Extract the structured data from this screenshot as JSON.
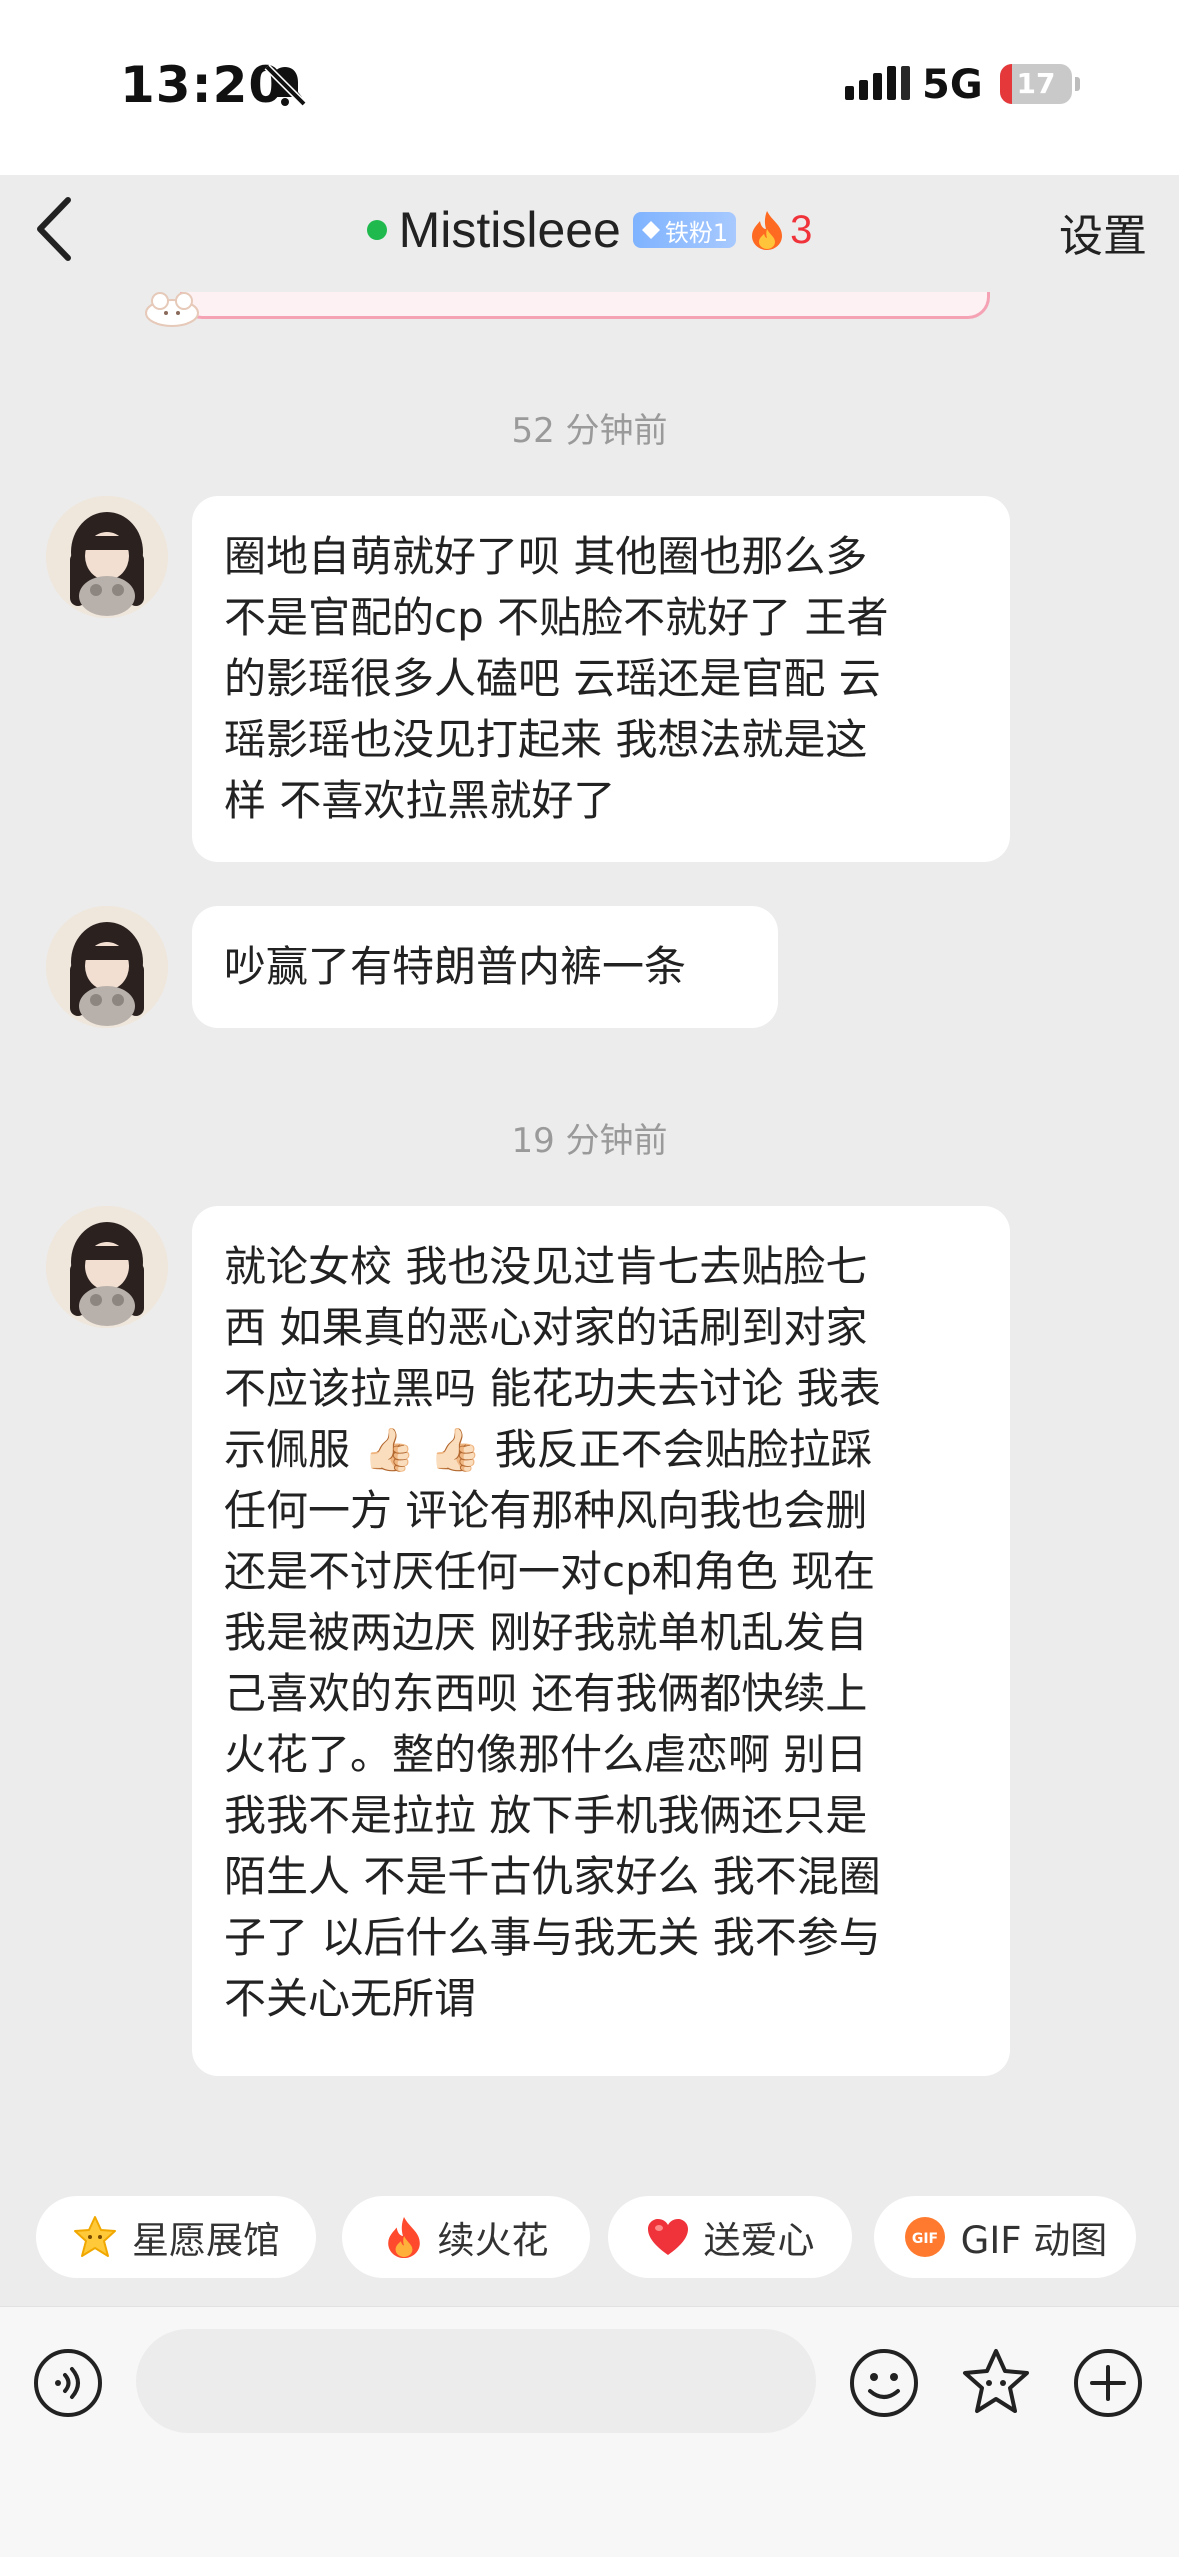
{
  "status_bar": {
    "time": "13:20",
    "network": "5G",
    "battery": "17",
    "battery_level": 0.17
  },
  "header": {
    "name": "Mistisleee",
    "online_color": "#1fb94e",
    "fan_badge": "铁粉1",
    "fire_count": "3",
    "settings_label": "设置"
  },
  "chat": {
    "timestamps": [
      "52 分钟前",
      "19 分钟前"
    ],
    "messages": [
      {
        "sender": "Mistisleee",
        "lines": [
          "圈地自萌就好了呗 其他圈也那么多",
          "不是官配的cp 不贴脸不就好了 王者",
          "的影瑶很多人磕吧 云瑶还是官配 云",
          "瑶影瑶也没见打起来 我想法就是这",
          "样 不喜欢拉黑就好了"
        ]
      },
      {
        "sender": "Mistisleee",
        "lines": [
          "吵赢了有特朗普内裤一条"
        ]
      },
      {
        "sender": "Mistisleee",
        "lines": [
          "就论女校 我也没见过肯七去贴脸七",
          "西 如果真的恶心对家的话刷到对家",
          "不应该拉黑吗  能花功夫去讨论 我表",
          "示佩服 👍🏻 👍🏻 我反正不会贴脸拉踩",
          "任何一方 评论有那种风向我也会删",
          "还是不讨厌任何一对cp和角色 现在",
          "我是被两边厌 刚好我就单机乱发自",
          "己喜欢的东西呗 还有我俩都快续上",
          "火花了。整的像那什么虐恋啊  别日",
          "我我不是拉拉 放下手机我俩还只是",
          "陌生人 不是千古仇家好么 我不混圈",
          "子了  以后什么事与我无关 我不参与",
          "不关心无所谓"
        ]
      }
    ]
  },
  "quick_actions": [
    {
      "icon": "star-icon",
      "label": "星愿展馆"
    },
    {
      "icon": "fire-icon",
      "label": "续火花"
    },
    {
      "icon": "heart-icon",
      "label": "送爱心"
    },
    {
      "icon": "gif-icon",
      "label": "GIF 动图"
    }
  ],
  "input": {
    "placeholder": ""
  },
  "colors": {
    "accent_red": "#f0333a",
    "badge_blue": "#7fb3ff",
    "chat_bg": "#ececec",
    "bubble_bg": "#ffffff"
  }
}
